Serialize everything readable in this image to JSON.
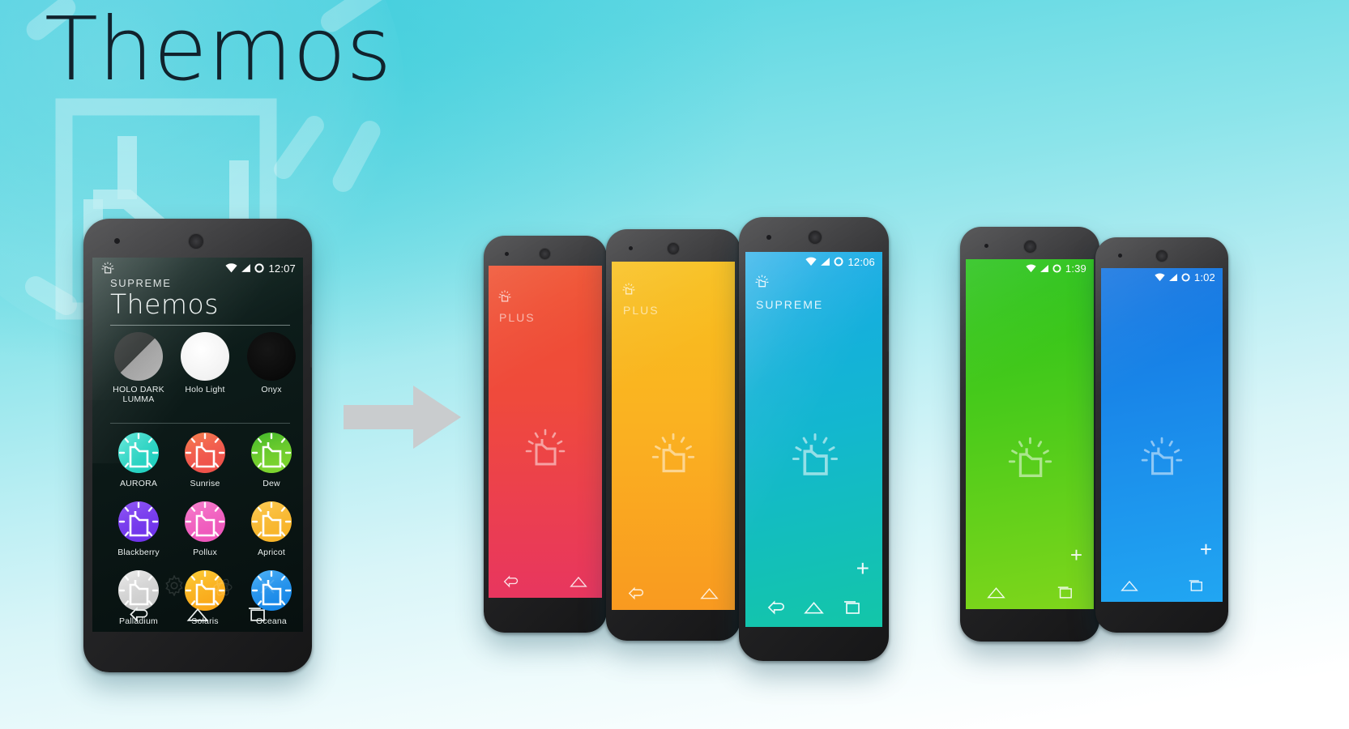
{
  "brand": {
    "title": "Themos",
    "title_color": "#11222c",
    "background_top": "#55d3e3",
    "background_bottom": "#ffffff"
  },
  "arrow": {
    "name": "right-arrow",
    "color": "#c9ccce"
  },
  "main_phone": {
    "status_bar": {
      "time": "12:07",
      "icons": [
        "wifi-icon",
        "signal-icon",
        "battery-icon"
      ],
      "notification": "themos-bulb-icon"
    },
    "header": {
      "eyebrow": "SUPREME",
      "title": "Themos"
    },
    "base_themes": [
      {
        "label": "HOLO DARK LUMMA",
        "color": "#9a9a9a",
        "style": "half-dark"
      },
      {
        "label": "Holo Light",
        "color": "#f4f4f4",
        "style": "solid"
      },
      {
        "label": "Onyx",
        "color": "#0a0a0a",
        "style": "solid"
      }
    ],
    "themes": [
      {
        "label": "AURORA",
        "color": "#23d5c4",
        "color2": "#45e0d0"
      },
      {
        "label": "Sunrise",
        "color": "#ef5b42",
        "color2": "#f1553f"
      },
      {
        "label": "Dew",
        "color": "#5ac432",
        "color2": "#8ddc2e"
      },
      {
        "label": "Blackberry",
        "color": "#7b3ff2",
        "color2": "#9450f5"
      },
      {
        "label": "Pollux",
        "color": "#f160c0",
        "color2": "#f878c8"
      },
      {
        "label": "Apricot",
        "color": "#fbbe32",
        "color2": "#fcc94a"
      },
      {
        "label": "Palladium",
        "color": "#d8d8d8",
        "color2": "#eaeaea"
      },
      {
        "label": "Solaris",
        "color": "#fcbe1e",
        "color2": "#fdd23c"
      },
      {
        "label": "Oceana",
        "color": "#2196f3",
        "color2": "#3eb1f7"
      }
    ],
    "nav_bar": [
      "back-icon",
      "home-icon",
      "recents-icon"
    ]
  },
  "preview_phones": [
    {
      "name": "red-phone",
      "label": "PLUS",
      "label_type": "plus",
      "time": "",
      "show_status_icons": false,
      "show_fab": false,
      "bg_top": "#ef5130",
      "bg_bottom": "#e8365f",
      "nav_bar": [
        "back-icon",
        "home-icon"
      ]
    },
    {
      "name": "orange-phone",
      "label": "PLUS",
      "label_type": "plus",
      "time": "",
      "show_status_icons": false,
      "show_fab": false,
      "bg_top": "#f8c01e",
      "bg_bottom": "#f99a20",
      "nav_bar": [
        "back-icon",
        "home-icon"
      ]
    },
    {
      "name": "cyan-phone",
      "label": "SUPREME",
      "label_type": "supreme",
      "time": "12:06",
      "show_status_icons": true,
      "show_fab": true,
      "bg_top": "#17a9e8",
      "bg_bottom": "#13c6a8",
      "nav_bar": [
        "back-icon",
        "home-icon",
        "recents-icon"
      ]
    },
    {
      "name": "green-phone",
      "label": "",
      "label_type": "none",
      "time": "1:39",
      "show_status_icons": true,
      "show_fab": true,
      "bg_top": "#27c21a",
      "bg_bottom": "#7fd61b",
      "nav_bar": [
        "home-icon",
        "recents-icon"
      ]
    },
    {
      "name": "blue-phone",
      "label": "",
      "label_type": "none",
      "time": "1:02",
      "show_status_icons": true,
      "show_fab": true,
      "bg_top": "#1273e0",
      "bg_bottom": "#21a6f2",
      "nav_bar": [
        "home-icon",
        "recents-icon"
      ]
    }
  ]
}
